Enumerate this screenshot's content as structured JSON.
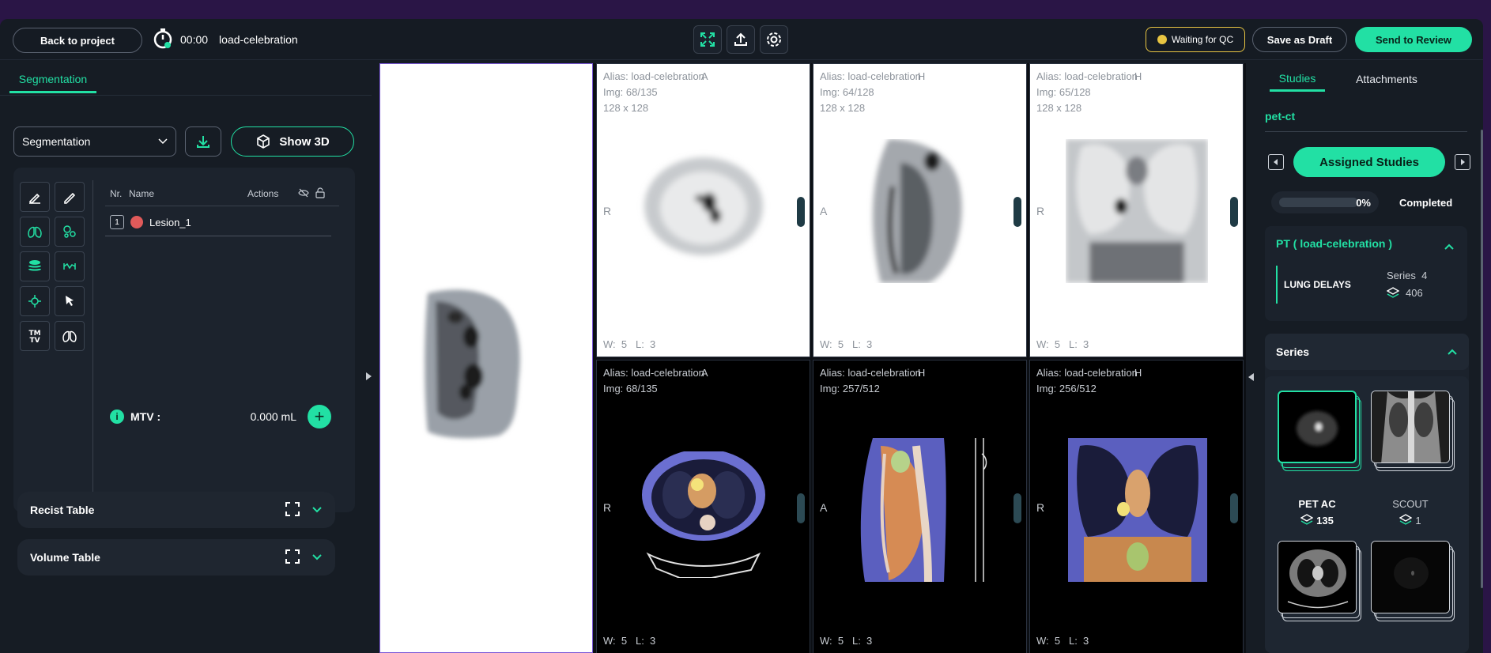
{
  "topbar": {
    "back_label": "Back to project",
    "timer": "00:00",
    "task_name": "load-celebration",
    "status_label": "Waiting for QC",
    "draft_label": "Save as Draft",
    "send_label": "Send to Review"
  },
  "left_panel": {
    "tab_label": "Segmentation",
    "select_value": "Segmentation",
    "show3d_label": "Show 3D",
    "table_headers": {
      "nr": "Nr.",
      "name": "Name",
      "actions": "Actions"
    },
    "lesions": [
      {
        "num": "1",
        "name": "Lesion_1",
        "color": "#e05a5a"
      }
    ],
    "mtv_label": "MTV :",
    "mtv_value": "0.000 mL",
    "accordions": [
      {
        "label": "Recist Table"
      },
      {
        "label": "Volume Table"
      }
    ],
    "tool_icons": [
      "brush-icon",
      "pencil-icon",
      "lungs-icon",
      "bubbles-icon",
      "layers-icon",
      "measure-icon",
      "crosshair-icon",
      "pointer-icon",
      "tmtv-icon",
      "lungs-outline-icon"
    ]
  },
  "viewports": [
    {
      "alias": "Alias: load-celebration",
      "letter": "A",
      "img": "Img: 68/135",
      "size": "128 x 128",
      "orient": "R",
      "w": "W:",
      "wv": "5",
      "l": "L:",
      "lv": "3"
    },
    {
      "alias": "Alias: load-celebration",
      "letter": "H",
      "img": "Img: 64/128",
      "size": "128 x 128",
      "orient": "A",
      "w": "W:",
      "wv": "5",
      "l": "L:",
      "lv": "3"
    },
    {
      "alias": "Alias: load-celebration",
      "letter": "H",
      "img": "Img: 65/128",
      "size": "128 x 128",
      "orient": "R",
      "w": "W:",
      "wv": "5",
      "l": "L:",
      "lv": "3"
    },
    {
      "alias": "Alias: load-celebration",
      "letter": "A",
      "img": "Img: 68/135",
      "size": "",
      "orient": "R",
      "w": "W:",
      "wv": "5",
      "l": "L:",
      "lv": "3"
    },
    {
      "alias": "Alias: load-celebration",
      "letter": "H",
      "img": "Img: 257/512",
      "size": "",
      "orient": "A",
      "w": "W:",
      "wv": "5",
      "l": "L:",
      "lv": "3"
    },
    {
      "alias": "Alias: load-celebration",
      "letter": "H",
      "img": "Img: 256/512",
      "size": "",
      "orient": "R",
      "w": "W:",
      "wv": "5",
      "l": "L:",
      "lv": "3"
    }
  ],
  "right_panel": {
    "tabs": [
      "Studies",
      "Attachments"
    ],
    "project": "pet-ct",
    "assigned_label": "Assigned Studies",
    "progress_pct": "0%",
    "progress_value": 0,
    "completed_label": "Completed",
    "study": {
      "title": "PT ( load-celebration )",
      "name": "LUNG DELAYS",
      "series_label": "Series",
      "series_count": "4",
      "instances": "406"
    },
    "series_header": "Series",
    "series": [
      {
        "name": "PET AC",
        "count": "135",
        "selected": true
      },
      {
        "name": "SCOUT",
        "count": "1",
        "selected": false
      }
    ]
  },
  "colors": {
    "accent": "#22e0a4",
    "warning": "#e8c542",
    "background": "#161c24",
    "lesion": "#e05a5a"
  }
}
